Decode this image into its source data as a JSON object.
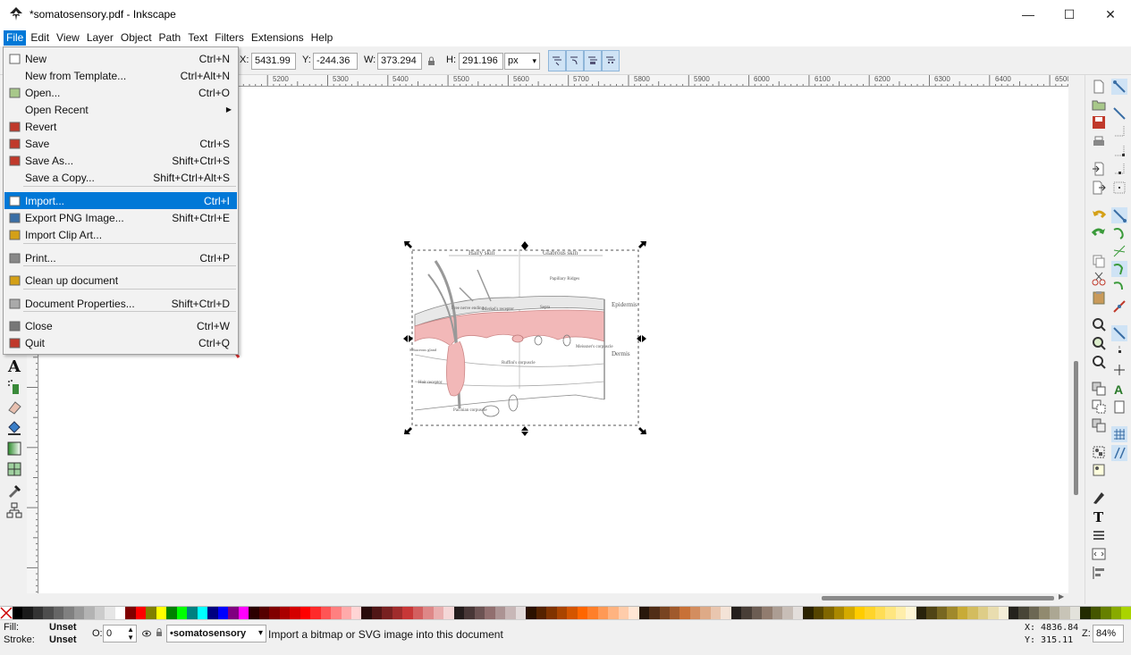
{
  "window": {
    "title": "*somatosensory.pdf - Inkscape",
    "minimize": "—",
    "maximize": "☐",
    "close": "✕"
  },
  "menubar": [
    "File",
    "Edit",
    "View",
    "Layer",
    "Object",
    "Path",
    "Text",
    "Filters",
    "Extensions",
    "Help"
  ],
  "file_menu": {
    "items": [
      {
        "label": "New",
        "shortcut": "Ctrl+N",
        "icon": "new-document-icon"
      },
      {
        "label": "New from Template...",
        "shortcut": "Ctrl+Alt+N",
        "icon": ""
      },
      {
        "label": "Open...",
        "shortcut": "Ctrl+O",
        "icon": "open-folder-icon"
      },
      {
        "label": "Open Recent",
        "shortcut": "",
        "icon": "",
        "submenu": true
      },
      {
        "label": "Revert",
        "shortcut": "",
        "icon": "revert-icon"
      },
      {
        "label": "Save",
        "shortcut": "Ctrl+S",
        "icon": "save-icon"
      },
      {
        "label": "Save As...",
        "shortcut": "Shift+Ctrl+S",
        "icon": "save-as-icon"
      },
      {
        "label": "Save a Copy...",
        "shortcut": "Shift+Ctrl+Alt+S",
        "icon": ""
      },
      {
        "label": "Import...",
        "shortcut": "Ctrl+I",
        "icon": "import-icon",
        "highlighted": true
      },
      {
        "label": "Export PNG Image...",
        "shortcut": "Shift+Ctrl+E",
        "icon": "export-png-icon"
      },
      {
        "label": "Import Clip Art...",
        "shortcut": "",
        "icon": "clip-art-icon"
      },
      {
        "label": "Print...",
        "shortcut": "Ctrl+P",
        "icon": "print-icon"
      },
      {
        "label": "Clean up document",
        "shortcut": "",
        "icon": "clean-up-icon"
      },
      {
        "label": "Document Properties...",
        "shortcut": "Shift+Ctrl+D",
        "icon": "document-properties-icon"
      },
      {
        "label": "Close",
        "shortcut": "Ctrl+W",
        "icon": "close-document-icon"
      },
      {
        "label": "Quit",
        "shortcut": "Ctrl+Q",
        "icon": "quit-icon"
      }
    ]
  },
  "toolbar": {
    "x_label": "X:",
    "x_value": "5431.99",
    "y_label": "Y:",
    "y_value": "-244.36",
    "w_label": "W:",
    "w_value": "373.294",
    "h_label": "H:",
    "h_value": "291.196",
    "unit": "px"
  },
  "ruler_top_labels": [
    "5200",
    "5300",
    "5400",
    "5500",
    "5600",
    "5700",
    "5800",
    "5900",
    "6000",
    "6100",
    "6200",
    "6300",
    "6400",
    "6500",
    "65"
  ],
  "figure": {
    "labels": [
      "Hairy skin",
      "Glabrous skin",
      "Papillary Ridges",
      "Epidermis",
      "Septa",
      "Free nerve ending",
      "Merkel's receptor",
      "Sebaceous gland",
      "Ruffini's corpuscle",
      "Meissner's corpuscle",
      "Dermis",
      "Hair receptor",
      "Pacinian corpuscle"
    ]
  },
  "status": {
    "fill_label": "Fill:",
    "fill_value": "Unset",
    "stroke_label": "Stroke:",
    "stroke_value": "Unset",
    "opacity_label": "O:",
    "opacity_value": "0",
    "layer": "•somatosensory",
    "message": "Import a bitmap or SVG image into this document",
    "coord_x": "X: 4836.84",
    "coord_y": "Y:  315.11",
    "zoom_label": "Z:",
    "zoom": "84%"
  },
  "palette_colors": [
    "#000000",
    "#1a1a1a",
    "#333333",
    "#4d4d4d",
    "#666666",
    "#808080",
    "#999999",
    "#b3b3b3",
    "#cccccc",
    "#e6e6e6",
    "#ffffff",
    "#800000",
    "#ff0000",
    "#808000",
    "#ffff00",
    "#008000",
    "#00ff00",
    "#008080",
    "#00ffff",
    "#000080",
    "#0000ff",
    "#800080",
    "#ff00ff",
    "#2b0000",
    "#550000",
    "#800000",
    "#aa0000",
    "#d40000",
    "#ff0000",
    "#ff2a2a",
    "#ff5555",
    "#ff8080",
    "#ffaaaa",
    "#ffd5d5",
    "#280b0b",
    "#501616",
    "#782121",
    "#a02c2c",
    "#c83737",
    "#d35f5f",
    "#de8787",
    "#e9afaf",
    "#f4d7d7",
    "#241c1c",
    "#483737",
    "#6c5353",
    "#916f6f",
    "#ac9393",
    "#c8b7b7",
    "#e3dbdb",
    "#2b1100",
    "#552200",
    "#803300",
    "#aa4400",
    "#d45500",
    "#ff6600",
    "#ff7f2a",
    "#ff9955",
    "#ffb380",
    "#ffccaa",
    "#ffe6d5",
    "#28170b",
    "#502d16",
    "#784421",
    "#a05a2c",
    "#c87137",
    "#d38d5f",
    "#deaa87",
    "#e9c6af",
    "#f4e3d7",
    "#241f1c",
    "#483e37",
    "#6c5d53",
    "#917c6f",
    "#ac9d93",
    "#c8beb7",
    "#e3dedb",
    "#2b2200",
    "#554400",
    "#806600",
    "#aa8800",
    "#d4aa00",
    "#ffcc00",
    "#ffd42a",
    "#ffdd55",
    "#ffe680",
    "#ffeeaa",
    "#fff6d5",
    "#28220b",
    "#504416",
    "#786721",
    "#a0892c",
    "#c8ab37",
    "#d3bc5f",
    "#decd87",
    "#e9ddaf",
    "#f4eed7",
    "#24221c",
    "#484537",
    "#6c6753",
    "#918a6f",
    "#aca793",
    "#c8c4b7",
    "#e3e2db",
    "#222b00",
    "#445500",
    "#668000",
    "#88aa00",
    "#aad400"
  ]
}
